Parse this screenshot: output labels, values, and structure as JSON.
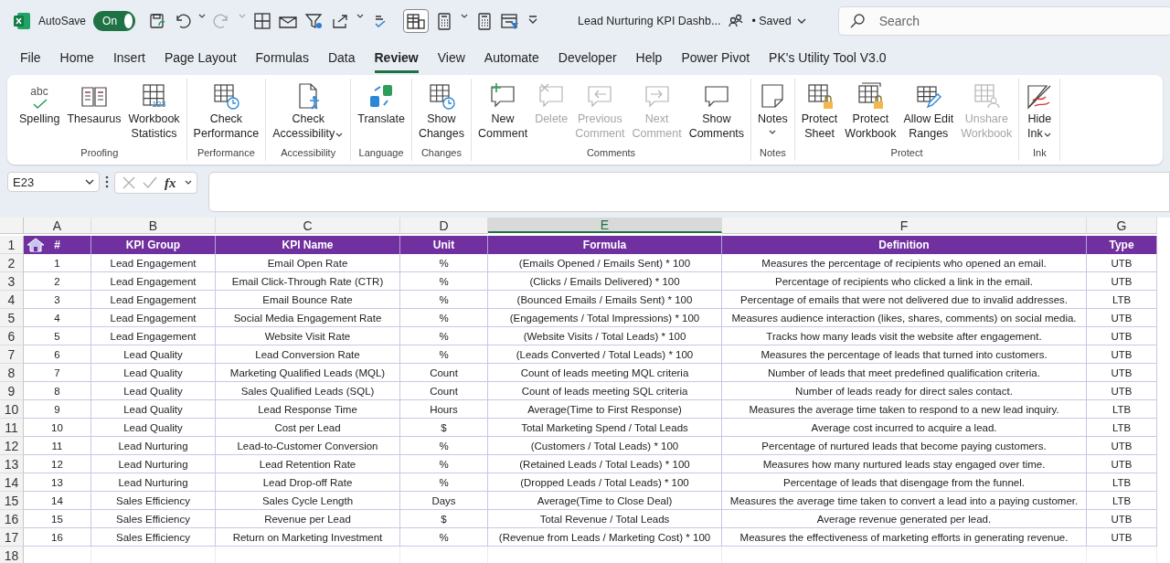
{
  "title_bar": {
    "autosave_label": "AutoSave",
    "autosave": {
      "on": true,
      "text": "On"
    },
    "document_title": "Lead Nurturing KPI Dashb...",
    "save_status": "• Saved",
    "search": {
      "placeholder": "Search"
    }
  },
  "tabs": [
    {
      "label": "File",
      "selected": false
    },
    {
      "label": "Home",
      "selected": false
    },
    {
      "label": "Insert",
      "selected": false
    },
    {
      "label": "Page Layout",
      "selected": false
    },
    {
      "label": "Formulas",
      "selected": false
    },
    {
      "label": "Data",
      "selected": false
    },
    {
      "label": "Review",
      "selected": true
    },
    {
      "label": "View",
      "selected": false
    },
    {
      "label": "Automate",
      "selected": false
    },
    {
      "label": "Developer",
      "selected": false
    },
    {
      "label": "Help",
      "selected": false
    },
    {
      "label": "Power Pivot",
      "selected": false
    },
    {
      "label": "PK's Utility Tool V3.0",
      "selected": false
    }
  ],
  "ribbon": {
    "groups": [
      {
        "label": "Proofing",
        "commands": [
          {
            "lines": [
              "Spelling"
            ],
            "glyph": "abc",
            "disabled": false,
            "menu": false
          },
          {
            "lines": [
              "Thesaurus"
            ],
            "disabled": false,
            "menu": false
          },
          {
            "lines": [
              "Workbook",
              "Statistics"
            ],
            "glyph": "123",
            "disabled": false,
            "menu": false
          }
        ]
      },
      {
        "label": "Performance",
        "commands": [
          {
            "lines": [
              "Check",
              "Performance"
            ],
            "disabled": false,
            "menu": false
          }
        ]
      },
      {
        "label": "Accessibility",
        "commands": [
          {
            "lines": [
              "Check",
              "Accessibility"
            ],
            "disabled": false,
            "menu": true
          }
        ]
      },
      {
        "label": "Language",
        "commands": [
          {
            "lines": [
              "Translate"
            ],
            "disabled": false,
            "menu": false
          }
        ]
      },
      {
        "label": "Changes",
        "commands": [
          {
            "lines": [
              "Show",
              "Changes"
            ],
            "disabled": false,
            "menu": false
          }
        ]
      },
      {
        "label": "Comments",
        "commands": [
          {
            "lines": [
              "New",
              "Comment"
            ],
            "disabled": false,
            "menu": false
          },
          {
            "lines": [
              "Delete"
            ],
            "disabled": true,
            "menu": false
          },
          {
            "lines": [
              "Previous",
              "Comment"
            ],
            "disabled": true,
            "menu": false
          },
          {
            "lines": [
              "Next",
              "Comment"
            ],
            "disabled": true,
            "menu": false
          },
          {
            "lines": [
              "Show",
              "Comments"
            ],
            "disabled": false,
            "menu": false
          }
        ]
      },
      {
        "label": "Notes",
        "commands": [
          {
            "lines": [
              "Notes"
            ],
            "disabled": false,
            "menu": true
          }
        ]
      },
      {
        "label": "Protect",
        "commands": [
          {
            "lines": [
              "Protect",
              "Sheet"
            ],
            "disabled": false,
            "menu": false
          },
          {
            "lines": [
              "Protect",
              "Workbook"
            ],
            "disabled": false,
            "menu": false
          },
          {
            "lines": [
              "Allow Edit",
              "Ranges"
            ],
            "disabled": false,
            "menu": false
          },
          {
            "lines": [
              "Unshare",
              "Workbook"
            ],
            "disabled": true,
            "menu": false
          }
        ]
      },
      {
        "label": "Ink",
        "commands": [
          {
            "lines": [
              "Hide",
              "Ink"
            ],
            "disabled": false,
            "menu": true
          }
        ]
      }
    ]
  },
  "formula_bar": {
    "name_box": "E23",
    "function_label": "fx"
  },
  "sheet": {
    "columns": [
      {
        "letter": "A",
        "selected": false
      },
      {
        "letter": "B",
        "selected": false
      },
      {
        "letter": "C",
        "selected": false
      },
      {
        "letter": "D",
        "selected": false
      },
      {
        "letter": "E",
        "selected": true
      },
      {
        "letter": "F",
        "selected": false
      },
      {
        "letter": "G",
        "selected": false
      }
    ],
    "row_numbers": [
      "1",
      "2",
      "3",
      "4",
      "5",
      "6",
      "7",
      "8",
      "9",
      "10",
      "11",
      "12",
      "13",
      "14",
      "15",
      "16",
      "17",
      "18"
    ],
    "headers": [
      "#",
      "KPI Group",
      "KPI Name",
      "Unit",
      "Formula",
      "Definition",
      "Type"
    ],
    "rows": [
      [
        "1",
        "Lead Engagement",
        "Email Open Rate",
        "%",
        "(Emails Opened / Emails Sent) * 100",
        "Measures the percentage of recipients who opened an email.",
        "UTB"
      ],
      [
        "2",
        "Lead Engagement",
        "Email Click-Through Rate (CTR)",
        "%",
        "(Clicks / Emails Delivered) * 100",
        "Percentage of recipients who clicked a link in the email.",
        "UTB"
      ],
      [
        "3",
        "Lead Engagement",
        "Email Bounce Rate",
        "%",
        "(Bounced Emails / Emails Sent) * 100",
        "Percentage of emails that were not delivered due to invalid addresses.",
        "LTB"
      ],
      [
        "4",
        "Lead Engagement",
        "Social Media Engagement Rate",
        "%",
        "(Engagements / Total Impressions) * 100",
        "Measures audience interaction (likes, shares, comments) on social media.",
        "UTB"
      ],
      [
        "5",
        "Lead Engagement",
        "Website Visit Rate",
        "%",
        "(Website Visits / Total Leads) * 100",
        "Tracks how many leads visit the website after engagement.",
        "UTB"
      ],
      [
        "6",
        "Lead Quality",
        "Lead Conversion Rate",
        "%",
        "(Leads Converted / Total Leads) * 100",
        "Measures the percentage of leads that turned into customers.",
        "UTB"
      ],
      [
        "7",
        "Lead Quality",
        "Marketing Qualified Leads (MQL)",
        "Count",
        "Count of leads meeting MQL criteria",
        "Number of leads that meet predefined qualification criteria.",
        "UTB"
      ],
      [
        "8",
        "Lead Quality",
        "Sales Qualified Leads (SQL)",
        "Count",
        "Count of leads meeting SQL criteria",
        "Number of leads ready for direct sales contact.",
        "UTB"
      ],
      [
        "9",
        "Lead Quality",
        "Lead Response Time",
        "Hours",
        "Average(Time to First Response)",
        "Measures the average time taken to respond to a new lead inquiry.",
        "LTB"
      ],
      [
        "10",
        "Lead Quality",
        "Cost per Lead",
        "$",
        "Total Marketing Spend / Total Leads",
        "Average cost incurred to acquire a lead.",
        "LTB"
      ],
      [
        "11",
        "Lead Nurturing",
        "Lead-to-Customer Conversion",
        "%",
        "(Customers / Total Leads) * 100",
        "Percentage of nurtured leads that become paying customers.",
        "UTB"
      ],
      [
        "12",
        "Lead Nurturing",
        "Lead Retention Rate",
        "%",
        "(Retained Leads / Total Leads) * 100",
        "Measures how many nurtured leads stay engaged over time.",
        "UTB"
      ],
      [
        "13",
        "Lead Nurturing",
        "Lead Drop-off Rate",
        "%",
        "(Dropped Leads / Total Leads) * 100",
        "Percentage of leads that disengage from the funnel.",
        "LTB"
      ],
      [
        "14",
        "Sales Efficiency",
        "Sales Cycle Length",
        "Days",
        "Average(Time to Close Deal)",
        "Measures the average time taken to convert a lead into a paying customer.",
        "LTB"
      ],
      [
        "15",
        "Sales Efficiency",
        "Revenue per Lead",
        "$",
        "Total Revenue / Total Leads",
        "Average revenue generated per lead.",
        "UTB"
      ],
      [
        "16",
        "Sales Efficiency",
        "Return on Marketing Investment",
        "%",
        "(Revenue from Leads / Marketing Cost) * 100",
        "Measures the effectiveness of marketing efforts in generating revenue.",
        "UTB"
      ]
    ]
  }
}
